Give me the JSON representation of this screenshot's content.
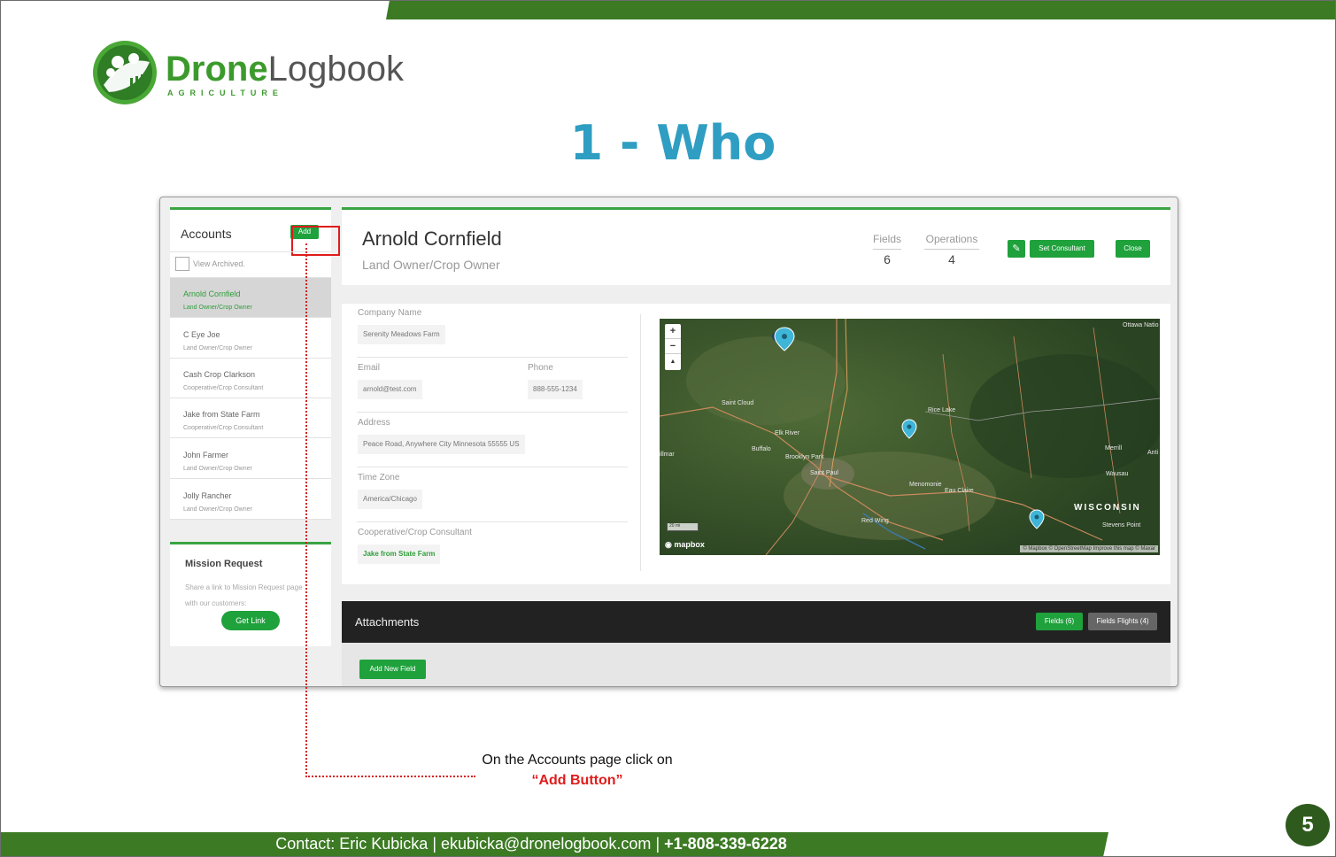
{
  "brand": {
    "name_bold": "Drone",
    "name_light": "Logbook",
    "subtitle": "AGRICULTURE",
    "logo_icon": "drone-leaf-logo-icon",
    "green": "#3c9a2d"
  },
  "slide": {
    "title": "1 - Who",
    "title_color": "#2f9ec2",
    "page_number": "5"
  },
  "accounts": {
    "title": "Accounts",
    "add_label": "Add",
    "view_archived": "View Archived.",
    "items": [
      {
        "name": "Arnold Cornfield",
        "role": "Land Owner/Crop Owner",
        "active": true
      },
      {
        "name": "C Eye Joe",
        "role": "Land Owner/Crop Owner",
        "active": false
      },
      {
        "name": "Cash Crop Clarkson",
        "role": "Cooperative/Crop Consultant",
        "active": false
      },
      {
        "name": "Jake from State Farm",
        "role": "Cooperative/Crop Consultant",
        "active": false
      },
      {
        "name": "John Farmer",
        "role": "Land Owner/Crop Owner",
        "active": false
      },
      {
        "name": "Jolly Rancher",
        "role": "Land Owner/Crop Owner",
        "active": false
      }
    ]
  },
  "mission": {
    "title": "Mission Request",
    "description": "Share a link to Mission Request page with our customers:",
    "button": "Get Link"
  },
  "profile": {
    "name": "Arnold Cornfield",
    "role": "Land Owner/Crop Owner",
    "fields_label": "Fields",
    "fields_value": "6",
    "operations_label": "Operations",
    "operations_value": "4",
    "edit_icon": "pencil-icon",
    "set_consultant": "Set Consultant",
    "close": "Close"
  },
  "details": {
    "company_label": "Company Name",
    "company_value": "Serenity Meadows Farm",
    "email_label": "Email",
    "email_value": "arnold@test.com",
    "phone_label": "Phone",
    "phone_value": "888-555-1234",
    "address_label": "Address",
    "address_value": "Peace Road, Anywhere City Minnesota 55555 US",
    "timezone_label": "Time Zone",
    "timezone_value": "America/Chicago",
    "consultant_label": "Cooperative/Crop Consultant",
    "consultant_value": "Jake from State Farm"
  },
  "map": {
    "zoom_in": "+",
    "zoom_out": "−",
    "compass": "▲",
    "labels": {
      "st_cloud": "Saint Cloud",
      "elk_river": "Elk River",
      "buffalo": "Buffalo",
      "brooklyn_park": "Brooklyn Park",
      "saint_paul": "Saint Paul",
      "rice_lake": "Rice Lake",
      "menomonie": "Menomonie",
      "eau_claire": "Eau Claire",
      "red_wing": "Red Wing",
      "merrill": "Merrill",
      "wausau": "Wausau",
      "stevens_point": "Stevens Point",
      "ottawa": "Ottawa Natio",
      "willmar": "illmar",
      "anti": "Anti"
    },
    "state": "WISCONSIN",
    "scale": "20 mi",
    "logo": "mapbox",
    "attribution": "© Mapbox © OpenStreetMap Improve this map © Maxar"
  },
  "attachments": {
    "title": "Attachments",
    "fields_tab": "Fields (6)",
    "flights_tab": "Fields Flights (4)",
    "add_field": "Add New Field"
  },
  "annotation": {
    "line1": "On the Accounts page click on",
    "line2": "“Add Button”"
  },
  "footer": {
    "contact": "Contact: Eric Kubicka",
    "sep1": "|",
    "email": "ekubicka@dronelogbook.com",
    "sep2": "|",
    "phone": "+1-808-339-6228"
  }
}
